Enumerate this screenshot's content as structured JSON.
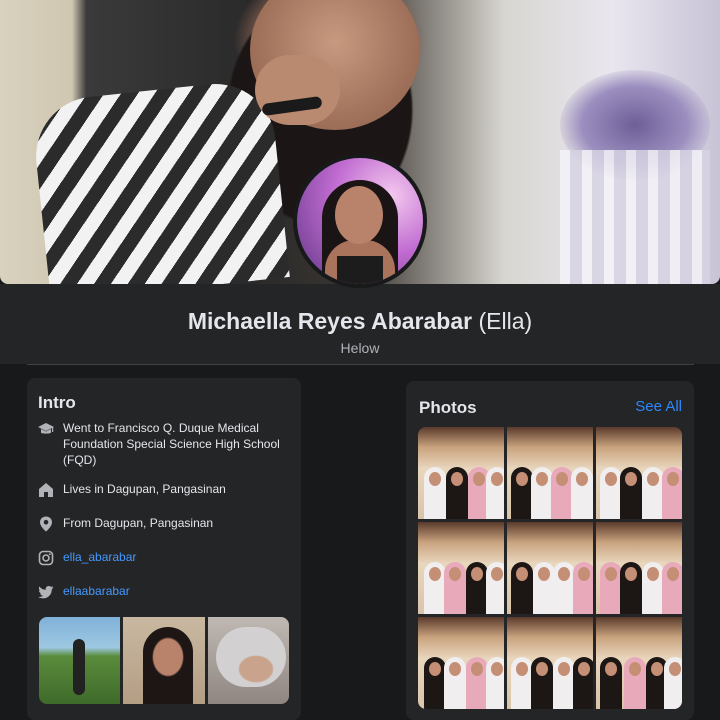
{
  "profile": {
    "name": "Michaella Reyes Abarabar",
    "nickname": "(Ella)",
    "bio": "Helow"
  },
  "intro": {
    "title": "Intro",
    "items": [
      {
        "icon": "graduation-cap-icon",
        "text": "Went to Francisco Q. Duque Medical Foundation Special Science High School (FQD)",
        "link": false
      },
      {
        "icon": "home-icon",
        "text": "Lives in Dagupan, Pangasinan",
        "link": false
      },
      {
        "icon": "location-pin-icon",
        "text": "From Dagupan, Pangasinan",
        "link": false
      },
      {
        "icon": "instagram-icon",
        "text": "ella_abarabar",
        "link": true
      },
      {
        "icon": "twitter-icon",
        "text": "ellaabarabar",
        "link": true
      }
    ]
  },
  "photos": {
    "title": "Photos",
    "see_all": "See All"
  },
  "colors": {
    "background": "#18191a",
    "card": "#242526",
    "text": "#e4e6eb",
    "secondary_text": "#b0b3b8",
    "link": "#2d88ff"
  }
}
